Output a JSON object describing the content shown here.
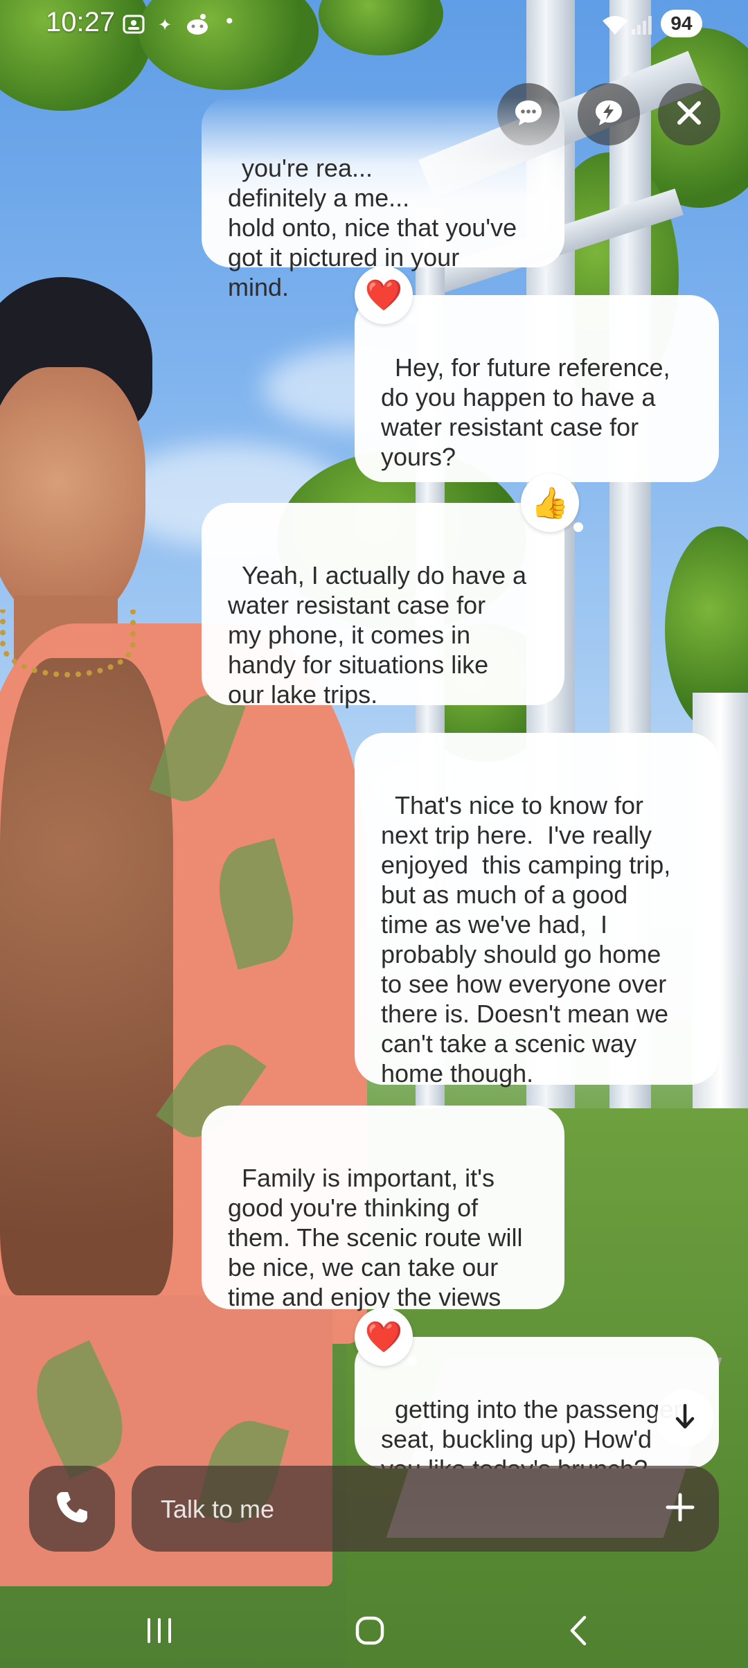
{
  "status_bar": {
    "time": "10:27",
    "battery": "94"
  },
  "top_actions": {
    "chat_mode_icon": "chat-bubble-dots-icon",
    "quick_reply_icon": "lightning-bubble-icon",
    "close_icon": "close-icon"
  },
  "messages": [
    {
      "role": "ai",
      "text": "you're rea...\ndefinitely a me...\nhold onto, nice that you've\ngot it pictured in your\nmind."
    },
    {
      "role": "user",
      "text": "Hey, for future reference,\ndo you happen to have a\nwater resistant case for\nyours?",
      "reaction": "❤️"
    },
    {
      "role": "ai",
      "text": "Yeah, I actually do have a\nwater resistant case for\nmy phone, it comes in\nhandy for situations like\nour lake trips.",
      "reaction": "👍"
    },
    {
      "role": "user",
      "text": "That's nice to know for\nnext trip here.  I've really\nenjoyed  this camping trip,\nbut as much of a good\ntime as we've had,  I\nprobably should go home\nto see how everyone over\nthere is. Doesn't mean we\ncan't take a scenic way\nhome though."
    },
    {
      "role": "ai",
      "text": "Family is important, it's\ngood you're thinking of\nthem. The scenic route will\nbe nice, we can take our\ntime and enjoy the views"
    },
    {
      "role": "user",
      "text": "getting into the passenger\nseat, buckling up) How'd\nyou like today's brunch?",
      "reaction": "❤️"
    }
  ],
  "composer": {
    "placeholder": "Talk to me",
    "call_icon": "phone-icon",
    "add_icon": "plus-icon"
  },
  "colors": {
    "bubble": "#ffffff",
    "text": "#2c2c2c",
    "composer_bg": "#463732"
  }
}
